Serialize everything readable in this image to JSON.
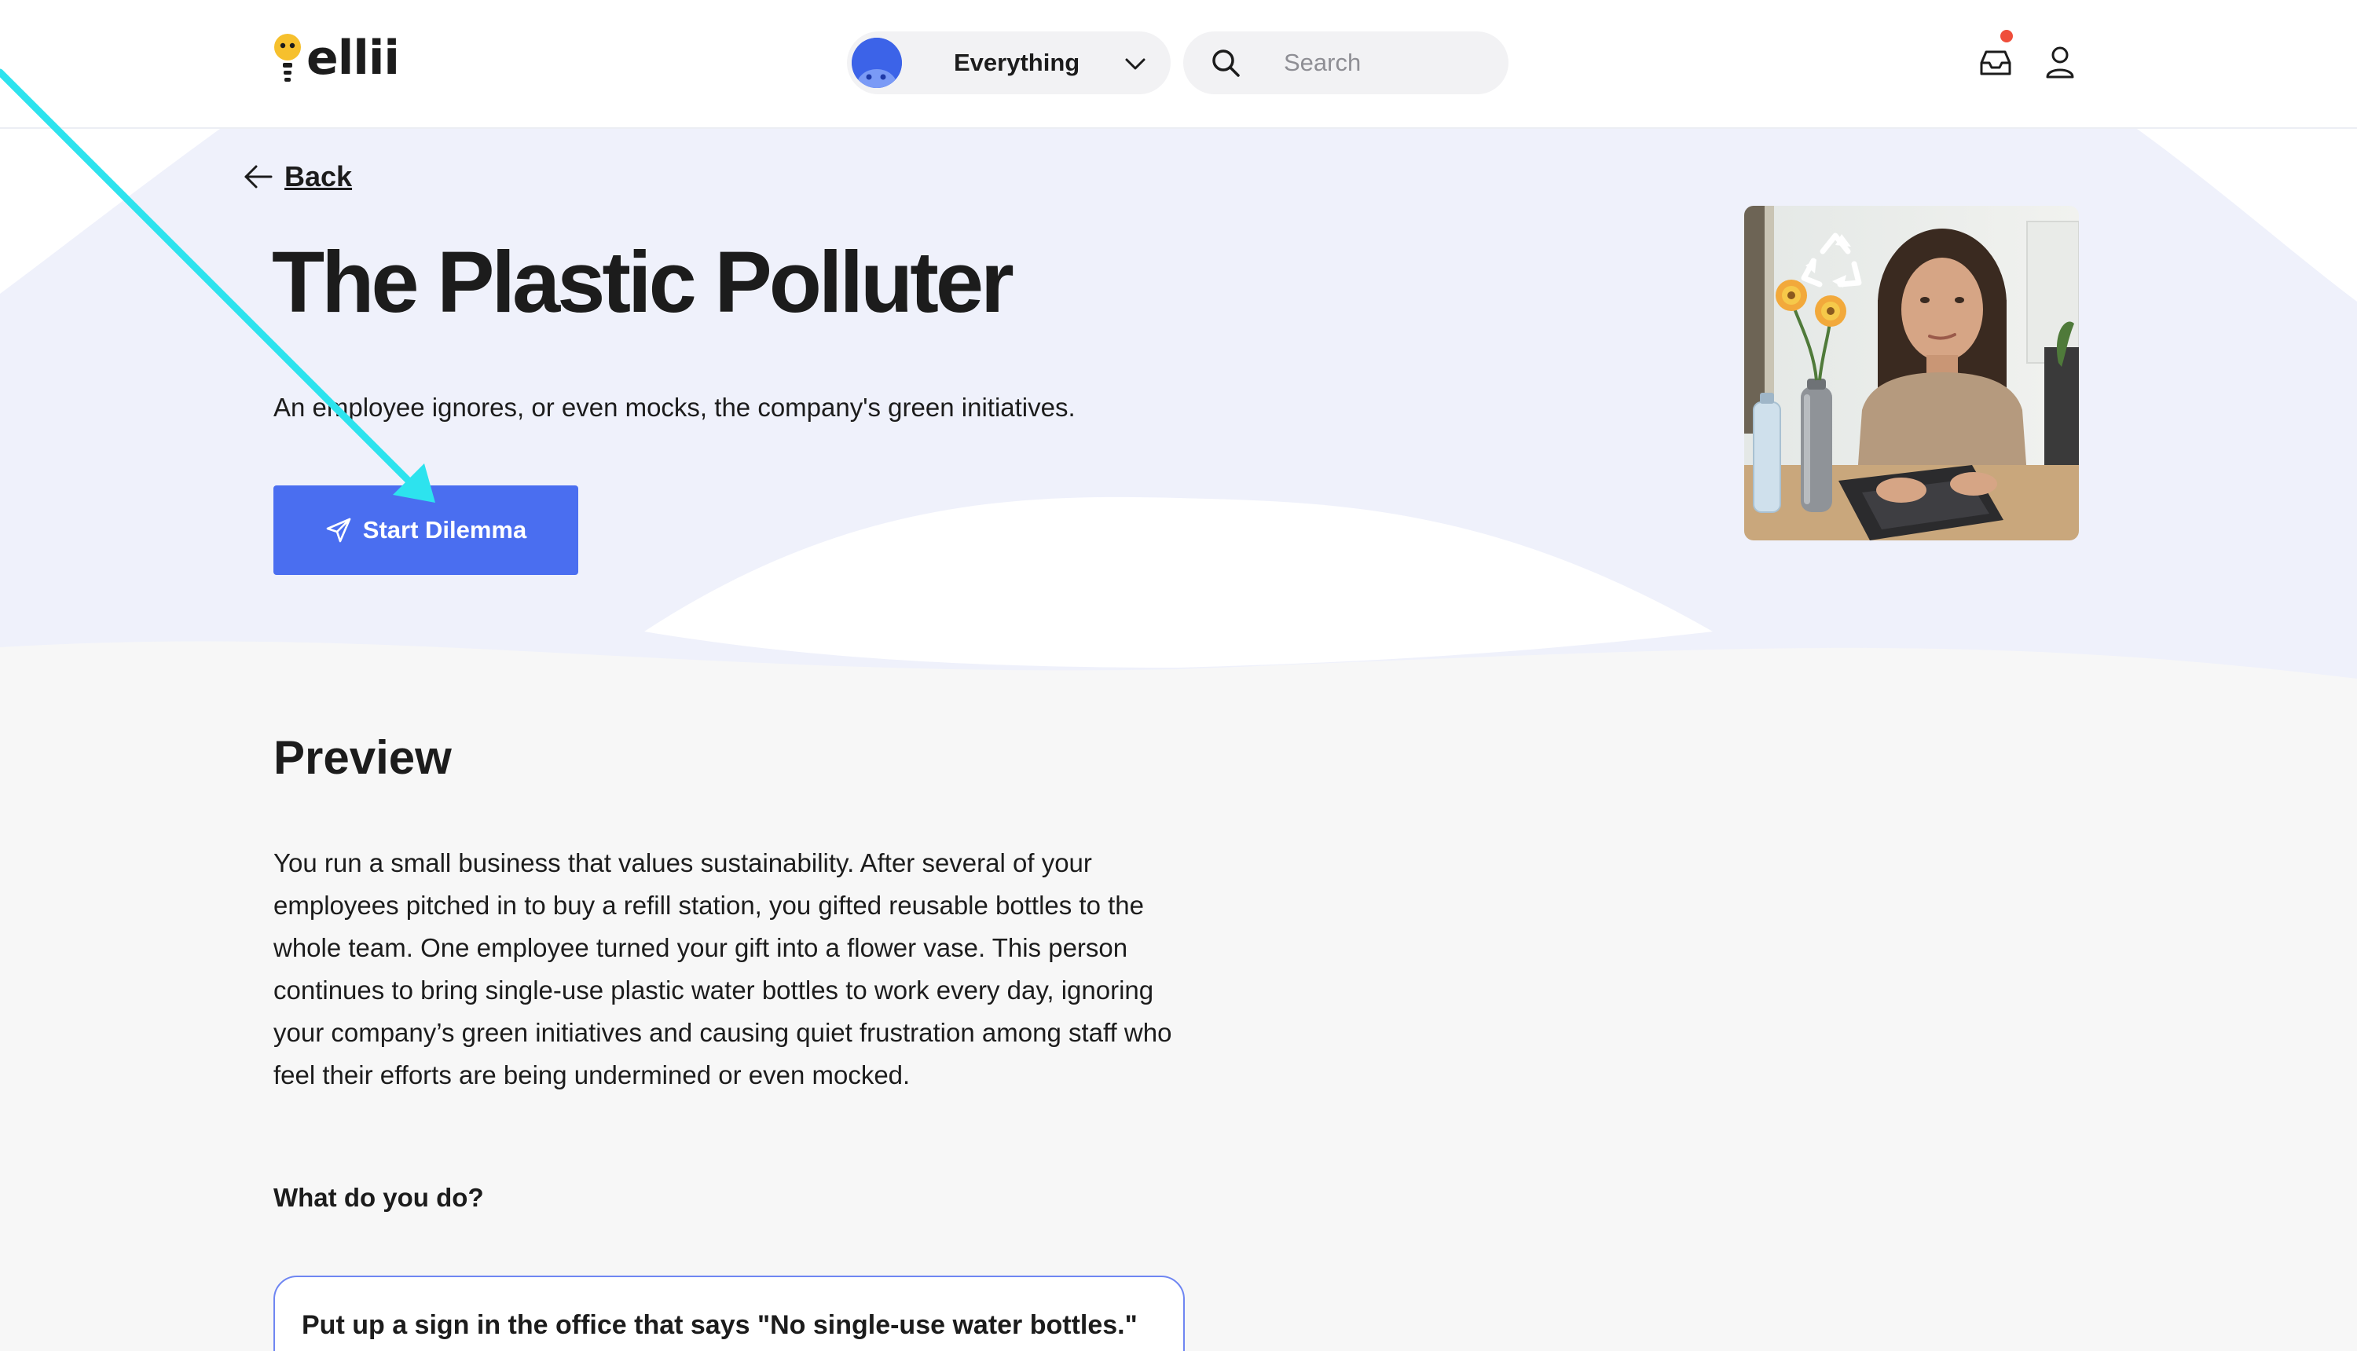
{
  "header": {
    "logo_text": "ellii",
    "category": {
      "label": "Everything"
    },
    "search": {
      "placeholder": "Search"
    },
    "has_notification": true
  },
  "hero": {
    "back_label": "Back",
    "title": "The Plastic Polluter",
    "subtitle": "An employee ignores, or even mocks, the company's green initiatives.",
    "start_button_label": "Start Dilemma"
  },
  "preview": {
    "heading": "Preview",
    "body": "You run a small business that values sustainability. After several of your employees pitched in to buy a refill station, you gifted reusable bottles to the whole team. One employee turned your gift into a flower vase. This person continues to bring single-use plastic water bottles to work every day, ignoring your company’s green initiatives and causing quiet frustration among staff who feel their efforts are being undermined or even mocked.",
    "question": "What do you do?",
    "options": [
      {
        "label": "Put up a sign in the office that says \"No single-use water bottles.\""
      }
    ]
  },
  "colors": {
    "accent": "#4a6ef0",
    "hero_background": "#eff1fb",
    "page_background": "#f7f7f7",
    "notification": "#ef4e3b",
    "logo_bulb": "#f6c02d",
    "annotation_arrow": "#2de3ee"
  },
  "icons": {
    "logo": "lightbulb-icon",
    "category_avatar": "avatar-icon",
    "category_chevron": "chevron-down-icon",
    "search": "search-icon",
    "inbox": "inbox-icon",
    "user": "user-icon",
    "back": "arrow-left-icon",
    "start": "send-icon"
  }
}
